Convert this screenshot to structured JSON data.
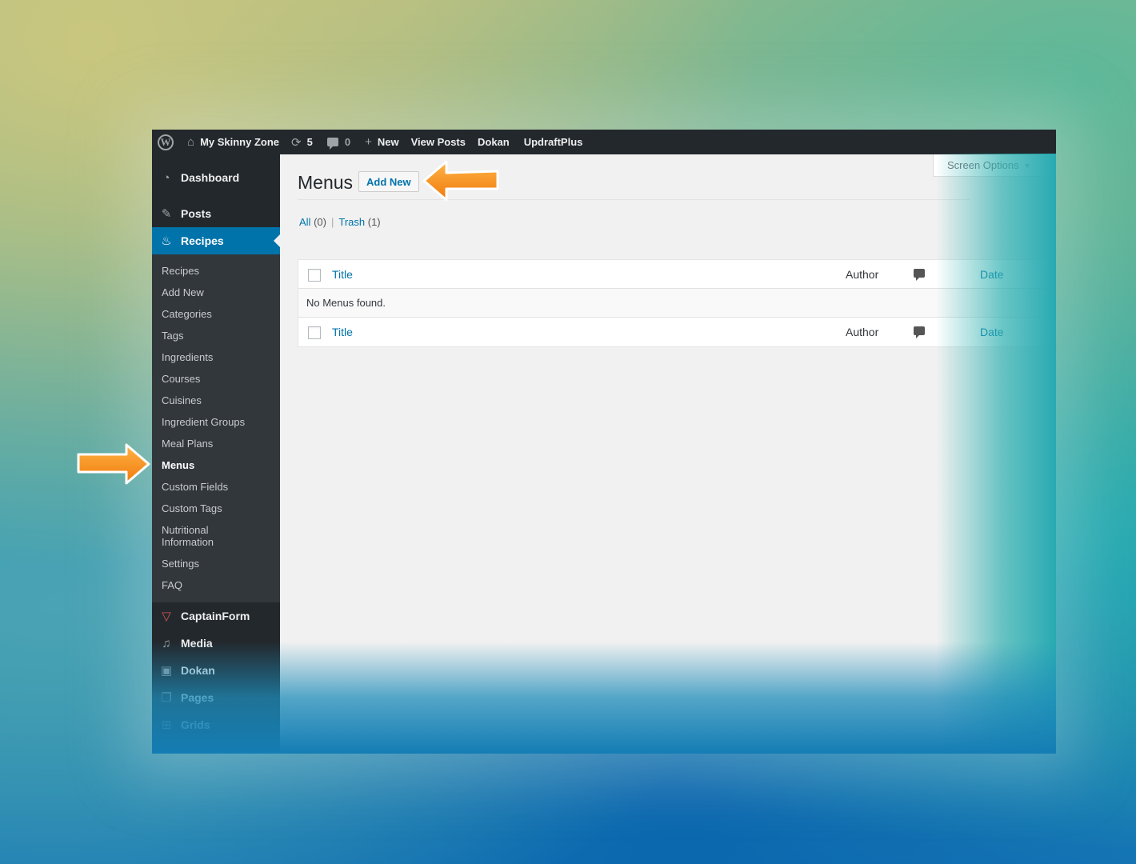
{
  "adminbar": {
    "site_name": "My Skinny Zone",
    "updates_count": "5",
    "comments_count": "0",
    "new_label": "New",
    "view_posts_label": "View Posts",
    "dokan_label": "Dokan",
    "updraft_label": "UpdraftPlus"
  },
  "sidebar": {
    "dashboard": "Dashboard",
    "posts": "Posts",
    "recipes": "Recipes",
    "recipes_submenu": [
      "Recipes",
      "Add New",
      "Categories",
      "Tags",
      "Ingredients",
      "Courses",
      "Cuisines",
      "Ingredient Groups",
      "Meal Plans",
      "Menus",
      "Custom Fields",
      "Custom Tags",
      "Nutritional Information",
      "Settings",
      "FAQ"
    ],
    "captainform": "CaptainForm",
    "media": "Media",
    "dokan": "Dokan",
    "pages": "Pages",
    "grids": "Grids"
  },
  "main": {
    "screen_options": "Screen Options",
    "page_title": "Menus",
    "add_new": "Add New",
    "filters": {
      "all_label": "All",
      "all_count": "(0)",
      "trash_label": "Trash",
      "trash_count": "(1)"
    },
    "table": {
      "col_title": "Title",
      "col_author": "Author",
      "col_date": "Date",
      "empty_message": "No Menus found."
    }
  },
  "colors": {
    "adminbar_bg": "#23282d",
    "sidebar_bg": "#23282d",
    "submenu_bg": "#32373c",
    "accent": "#0073aa",
    "arrow": "#f7931e"
  }
}
